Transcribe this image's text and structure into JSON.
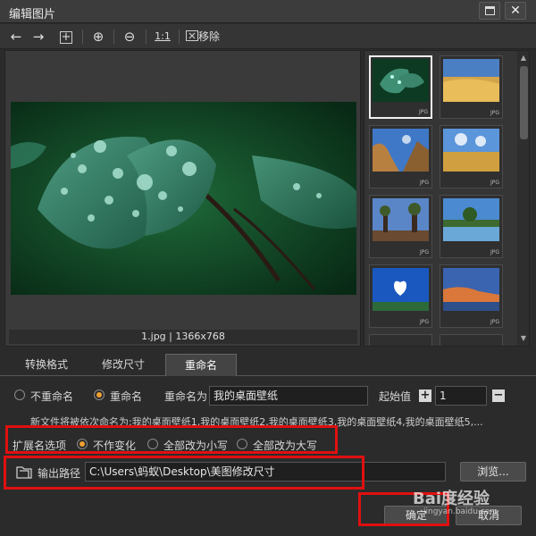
{
  "window": {
    "title": "编辑图片"
  },
  "toolbar": {
    "back_glyph": "←",
    "forward_glyph": "→",
    "add_glyph": "+",
    "zoom_in_glyph": "⊕",
    "zoom_out_glyph": "⊖",
    "actual_size_label": "1:1",
    "remove_label": "移除"
  },
  "viewer": {
    "caption": "1.jpg | 1366x768"
  },
  "thumbnails": {
    "format_label": "JPG",
    "items": [
      {
        "theme": "leaf",
        "selected": true
      },
      {
        "theme": "wheat",
        "selected": false
      },
      {
        "theme": "cliff-sky",
        "selected": false
      },
      {
        "theme": "field-clouds",
        "selected": false
      },
      {
        "theme": "baobab",
        "selected": false
      },
      {
        "theme": "lake",
        "selected": false
      },
      {
        "theme": "heart-cloud",
        "selected": false
      },
      {
        "theme": "sunset-coast",
        "selected": false
      }
    ]
  },
  "tabs": [
    {
      "label": "转换格式",
      "active": false
    },
    {
      "label": "修改尺寸",
      "active": false
    },
    {
      "label": "重命名",
      "active": true
    }
  ],
  "rename": {
    "no_rename_label": "不重命名",
    "rename_label": "重命名",
    "rename_as_label": "重命名为",
    "rename_as_value": "我的桌面壁纸",
    "start_label": "起始值",
    "start_value": "1",
    "preview_text": "新文件将被依次命名为:我的桌面壁纸1,我的桌面壁纸2,我的桌面壁纸3,我的桌面壁纸4,我的桌面壁纸5,..."
  },
  "extension": {
    "label": "扩展名选项",
    "options": [
      "不作变化",
      "全部改为小写",
      "全部改为大写"
    ],
    "selected_index": 0
  },
  "output": {
    "label": "输出路径",
    "path": "C:\\Users\\蚂蚁\\Desktop\\美图修改尺寸",
    "browse_label": "浏览..."
  },
  "footer": {
    "ok_label": "确定",
    "cancel_label": "取消"
  },
  "colors": {
    "accent": "#f0a030",
    "highlight_box": "#e01010"
  },
  "watermark": {
    "text": "Bai度经验",
    "sub": "jingyan.baidu.com"
  }
}
